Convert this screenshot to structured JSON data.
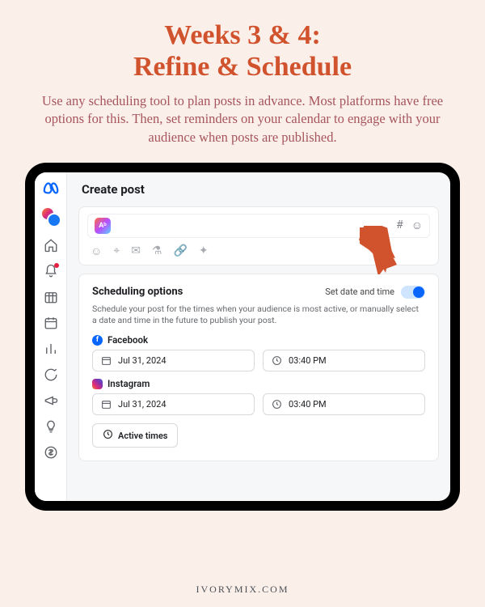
{
  "headline_line1": "Weeks 3 & 4:",
  "headline_line2": "Refine & Schedule",
  "description": "Use any scheduling tool to plan posts in advance. Most platforms have free options for this. Then, set reminders on your calendar to engage with your audience when posts are published.",
  "footer": "IVORYMIX.COM",
  "app": {
    "title": "Create post",
    "ab_badge": "Aᵇ",
    "scheduling": {
      "title": "Scheduling options",
      "toggle_label": "Set date and time",
      "toggle_on": true,
      "description": "Schedule your post for the times when your audience is most active, or manually select a date and time in the future to publish your post.",
      "platforms": [
        {
          "name": "Facebook",
          "date": "Jul 31, 2024",
          "time": "03:40 PM"
        },
        {
          "name": "Instagram",
          "date": "Jul 31, 2024",
          "time": "03:40 PM"
        }
      ],
      "active_times_label": "Active times"
    }
  },
  "colors": {
    "accent": "#d1532e",
    "meta_blue": "#0866ff"
  }
}
